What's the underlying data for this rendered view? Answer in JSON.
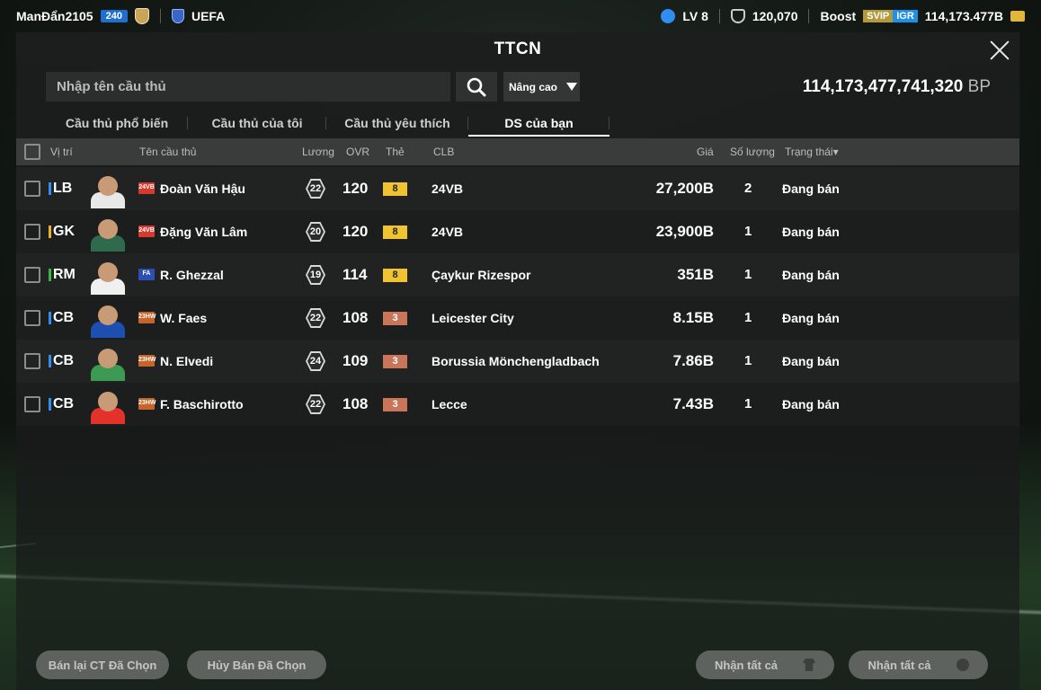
{
  "topbar": {
    "username": "ManĐẩn2105",
    "user_level": "240",
    "league": "UEFA",
    "lv": "LV 8",
    "points": "120,070",
    "boost_label": "Boost",
    "svip": "SVIP",
    "igr": "IGR",
    "balance": "114,173.477B"
  },
  "panel": {
    "title": "TTCN",
    "search_placeholder": "Nhập tên cầu thủ",
    "advanced_label": "Nâng cao",
    "bp_amount": "114,173,477,741,320",
    "bp_unit": "BP"
  },
  "tabs": [
    {
      "label": "Cầu thủ phổ biến"
    },
    {
      "label": "Cầu thủ của tôi"
    },
    {
      "label": "Cầu thủ yêu thích"
    },
    {
      "label": "DS của bạn"
    }
  ],
  "columns": {
    "position": "Vị trí",
    "name": "Tên cầu thủ",
    "salary": "Lương",
    "ovr": "OVR",
    "card": "Thẻ",
    "club": "CLB",
    "price": "Giá",
    "quantity": "Số lượng",
    "status": "Trạng thái▾"
  },
  "rows": [
    {
      "pos": "LB",
      "pos_color": "#2e8ff0",
      "season": "24VB",
      "season_color": "#d63a2f",
      "name": "Đoàn Văn Hậu",
      "salary": "22",
      "ovr": "120",
      "grade": "8",
      "grade_type": "gold",
      "club": "24VB",
      "price": "27,200B",
      "qty": "2",
      "status": "Đang bán",
      "kit": "#e8e8e8"
    },
    {
      "pos": "GK",
      "pos_color": "#e8b12c",
      "season": "24VB",
      "season_color": "#d63a2f",
      "name": "Đặng Văn Lâm",
      "salary": "20",
      "ovr": "120",
      "grade": "8",
      "grade_type": "gold",
      "club": "24VB",
      "price": "23,900B",
      "qty": "1",
      "status": "Đang bán",
      "kit": "#2f6a4c"
    },
    {
      "pos": "RM",
      "pos_color": "#39b54a",
      "season": "FA",
      "season_color": "#2d4fb5",
      "name": "R. Ghezzal",
      "salary": "19",
      "ovr": "114",
      "grade": "8",
      "grade_type": "gold",
      "club": "Çaykur Rizespor",
      "price": "351B",
      "qty": "1",
      "status": "Đang bán",
      "kit": "#f0f0f0"
    },
    {
      "pos": "CB",
      "pos_color": "#2e8ff0",
      "season": "23HW",
      "season_color": "#c7642b",
      "name": "W. Faes",
      "salary": "22",
      "ovr": "108",
      "grade": "3",
      "grade_type": "bronze",
      "club": "Leicester City",
      "price": "8.15B",
      "qty": "1",
      "status": "Đang bán",
      "kit": "#1c4fb0"
    },
    {
      "pos": "CB",
      "pos_color": "#2e8ff0",
      "season": "23HW",
      "season_color": "#c7642b",
      "name": "N. Elvedi",
      "salary": "24",
      "ovr": "109",
      "grade": "3",
      "grade_type": "bronze",
      "club": "Borussia Mönchengladbach",
      "price": "7.86B",
      "qty": "1",
      "status": "Đang bán",
      "kit": "#3d9a52"
    },
    {
      "pos": "CB",
      "pos_color": "#2e8ff0",
      "season": "23HW",
      "season_color": "#c7642b",
      "name": "F. Baschirotto",
      "salary": "22",
      "ovr": "108",
      "grade": "3",
      "grade_type": "bronze",
      "club": "Lecce",
      "price": "7.43B",
      "qty": "1",
      "status": "Đang bán",
      "kit": "#e4322b"
    }
  ],
  "buttons": {
    "resell": "Bán lại CT Đã Chọn",
    "cancel": "Hủy Bán Đã Chọn",
    "receive_all_1": "Nhận tất cả",
    "receive_all_2": "Nhận tất cả"
  }
}
